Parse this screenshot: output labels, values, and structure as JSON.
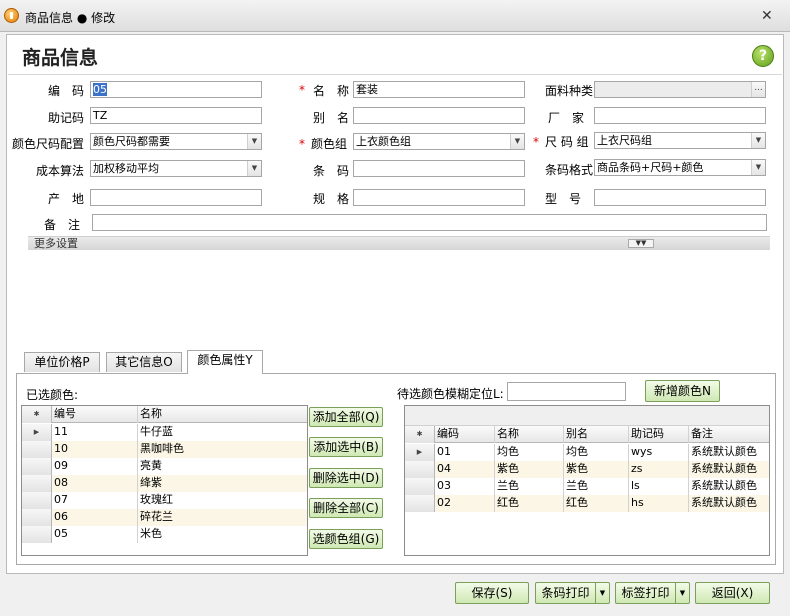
{
  "window": {
    "title": "商品信息 ● 修改"
  },
  "header": {
    "title": "商品信息",
    "help": "?"
  },
  "form": {
    "code": {
      "label": "编　码",
      "value": "05"
    },
    "name": {
      "label": "名　称",
      "value": "套装"
    },
    "fabric": {
      "label": "面料种类",
      "value": ""
    },
    "mnemonic": {
      "label": "助记码",
      "value": "TZ"
    },
    "alias": {
      "label": "别　名",
      "value": ""
    },
    "factory": {
      "label": "厂　家",
      "value": ""
    },
    "color_size_config": {
      "label": "颜色尺码配置",
      "value": "颜色尺码都需要"
    },
    "color_group": {
      "label": "颜色组",
      "value": "上衣颜色组"
    },
    "size_group": {
      "label": "尺 码 组",
      "value": "上衣尺码组"
    },
    "cost_method": {
      "label": "成本算法",
      "value": "加权移动平均"
    },
    "barcode": {
      "label": "条　码",
      "value": ""
    },
    "barcode_format": {
      "label": "条码格式",
      "value": "商品条码+尺码+颜色"
    },
    "origin": {
      "label": "产　地",
      "value": ""
    },
    "spec": {
      "label": "规　格",
      "value": ""
    },
    "model": {
      "label": "型　号",
      "value": ""
    },
    "remark": {
      "label": "备　注",
      "value": ""
    },
    "required_mark": "*",
    "ellipsis": "..."
  },
  "more_settings": {
    "label": "更多设置"
  },
  "tabs": [
    "单位价格P",
    "其它信息O",
    "颜色属性Y"
  ],
  "selected_colors": {
    "label": "已选颜色:",
    "columns": [
      "编号",
      "名称"
    ],
    "rows": [
      {
        "code": "11",
        "name": "牛仔蓝"
      },
      {
        "code": "10",
        "name": "黑咖啡色"
      },
      {
        "code": "09",
        "name": "亮黄"
      },
      {
        "code": "08",
        "name": "绛紫"
      },
      {
        "code": "07",
        "name": "玫瑰红"
      },
      {
        "code": "06",
        "name": "碎花兰"
      },
      {
        "code": "05",
        "name": "米色"
      }
    ]
  },
  "middle_buttons": [
    "添加全部(Q)",
    "添加选中(B)",
    "删除选中(D)",
    "删除全部(C)",
    "选颜色组(G)"
  ],
  "pending_colors": {
    "label": "待选颜色模糊定位L:",
    "search_value": "",
    "new_button": "新增颜色N",
    "columns": [
      "编码",
      "名称",
      "别名",
      "助记码",
      "备注"
    ],
    "rows": [
      {
        "code": "01",
        "name": "均色",
        "alias": "均色",
        "mnemonic": "wys",
        "remark": "系统默认颜色"
      },
      {
        "code": "04",
        "name": "紫色",
        "alias": "紫色",
        "mnemonic": "zs",
        "remark": "系统默认颜色"
      },
      {
        "code": "03",
        "name": "兰色",
        "alias": "兰色",
        "mnemonic": "ls",
        "remark": "系统默认颜色"
      },
      {
        "code": "02",
        "name": "红色",
        "alias": "红色",
        "mnemonic": "hs",
        "remark": "系统默认颜色"
      }
    ]
  },
  "footer": {
    "save": "保存(S)",
    "barcode_print": "条码打印",
    "label_print": "标签打印",
    "back": "返回(X)"
  }
}
